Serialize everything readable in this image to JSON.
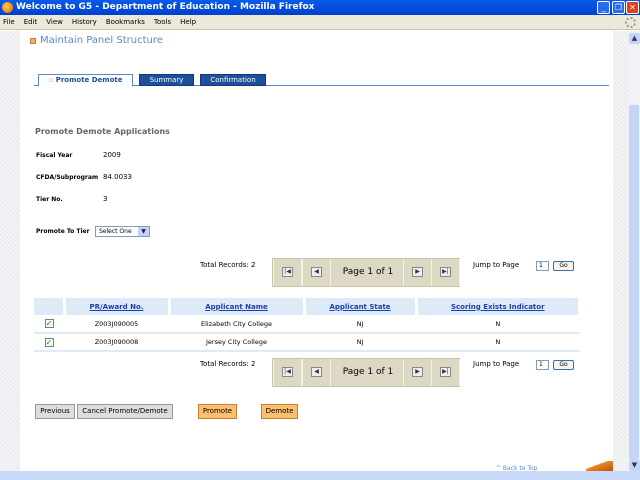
{
  "window": {
    "title": "Welcome to G5 - Department of Education - Mozilla Firefox"
  },
  "menu": [
    "File",
    "Edit",
    "View",
    "History",
    "Bookmarks",
    "Tools",
    "Help"
  ],
  "page": {
    "heading": "Maintain Panel Structure"
  },
  "tabs": [
    {
      "label": "Promote Demote",
      "active": true
    },
    {
      "label": "Summary"
    },
    {
      "label": "Confirmation"
    }
  ],
  "section": {
    "title": "Promote Demote Applications",
    "fields": [
      {
        "label": "Fiscal Year",
        "value": "2009"
      },
      {
        "label": "CFDA/Subprogram",
        "value": "84.0033"
      },
      {
        "label": "Tier No.",
        "value": "3"
      }
    ],
    "promote_label": "Promote To Tier",
    "promote_select": "Select One"
  },
  "pager": {
    "total": "Total Records: 2",
    "page": "Page 1 of 1",
    "jump_label": "Jump to Page",
    "jump_value": "1",
    "go": "Go"
  },
  "table": {
    "headers": [
      "PR/Award No.",
      "Applicant Name",
      "Applicant State",
      "Scoring Exists Indicator"
    ],
    "rows": [
      {
        "checked": true,
        "award": "Z003J090005",
        "name": "Elizabeth City College",
        "state": "NJ",
        "scoring": "N"
      },
      {
        "checked": true,
        "award": "Z003J090008",
        "name": "Jersey City College",
        "state": "NJ",
        "scoring": "N"
      }
    ]
  },
  "buttons": {
    "previous": "Previous",
    "cancel": "Cancel Promote/Demote",
    "promote": "Promote",
    "demote": "Demote"
  },
  "footer": {
    "back_to_top": "^ Back to Top"
  }
}
